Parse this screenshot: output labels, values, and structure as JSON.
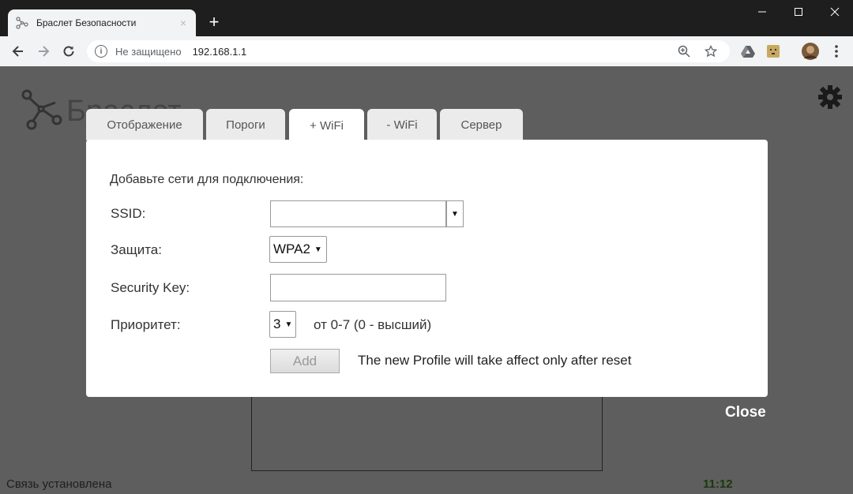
{
  "browser": {
    "tab_title": "Браслет Безопасности",
    "tab_close": "×",
    "new_tab": "+",
    "security_label": "Не защищено",
    "url": "192.168.1.1"
  },
  "page": {
    "logo_text": "Браслет",
    "close_label": "Close",
    "status_text": "Связь установлена",
    "clock": "11:12"
  },
  "tabs": [
    {
      "label": "Отображение"
    },
    {
      "label": "Пороги"
    },
    {
      "label": "+ WiFi"
    },
    {
      "label": "- WiFi"
    },
    {
      "label": "Сервер"
    }
  ],
  "form": {
    "heading": "Добавьте сети для подключения:",
    "ssid_label": "SSID:",
    "ssid_value": "",
    "security_label": "Защита:",
    "security_value": "WPA2",
    "key_label": "Security Key:",
    "key_value": "",
    "priority_label": "Приоритет:",
    "priority_value": "3",
    "priority_hint": "от 0-7 (0 - высший)",
    "add_label": "Add",
    "add_note": "The new Profile will take affect only after reset"
  }
}
